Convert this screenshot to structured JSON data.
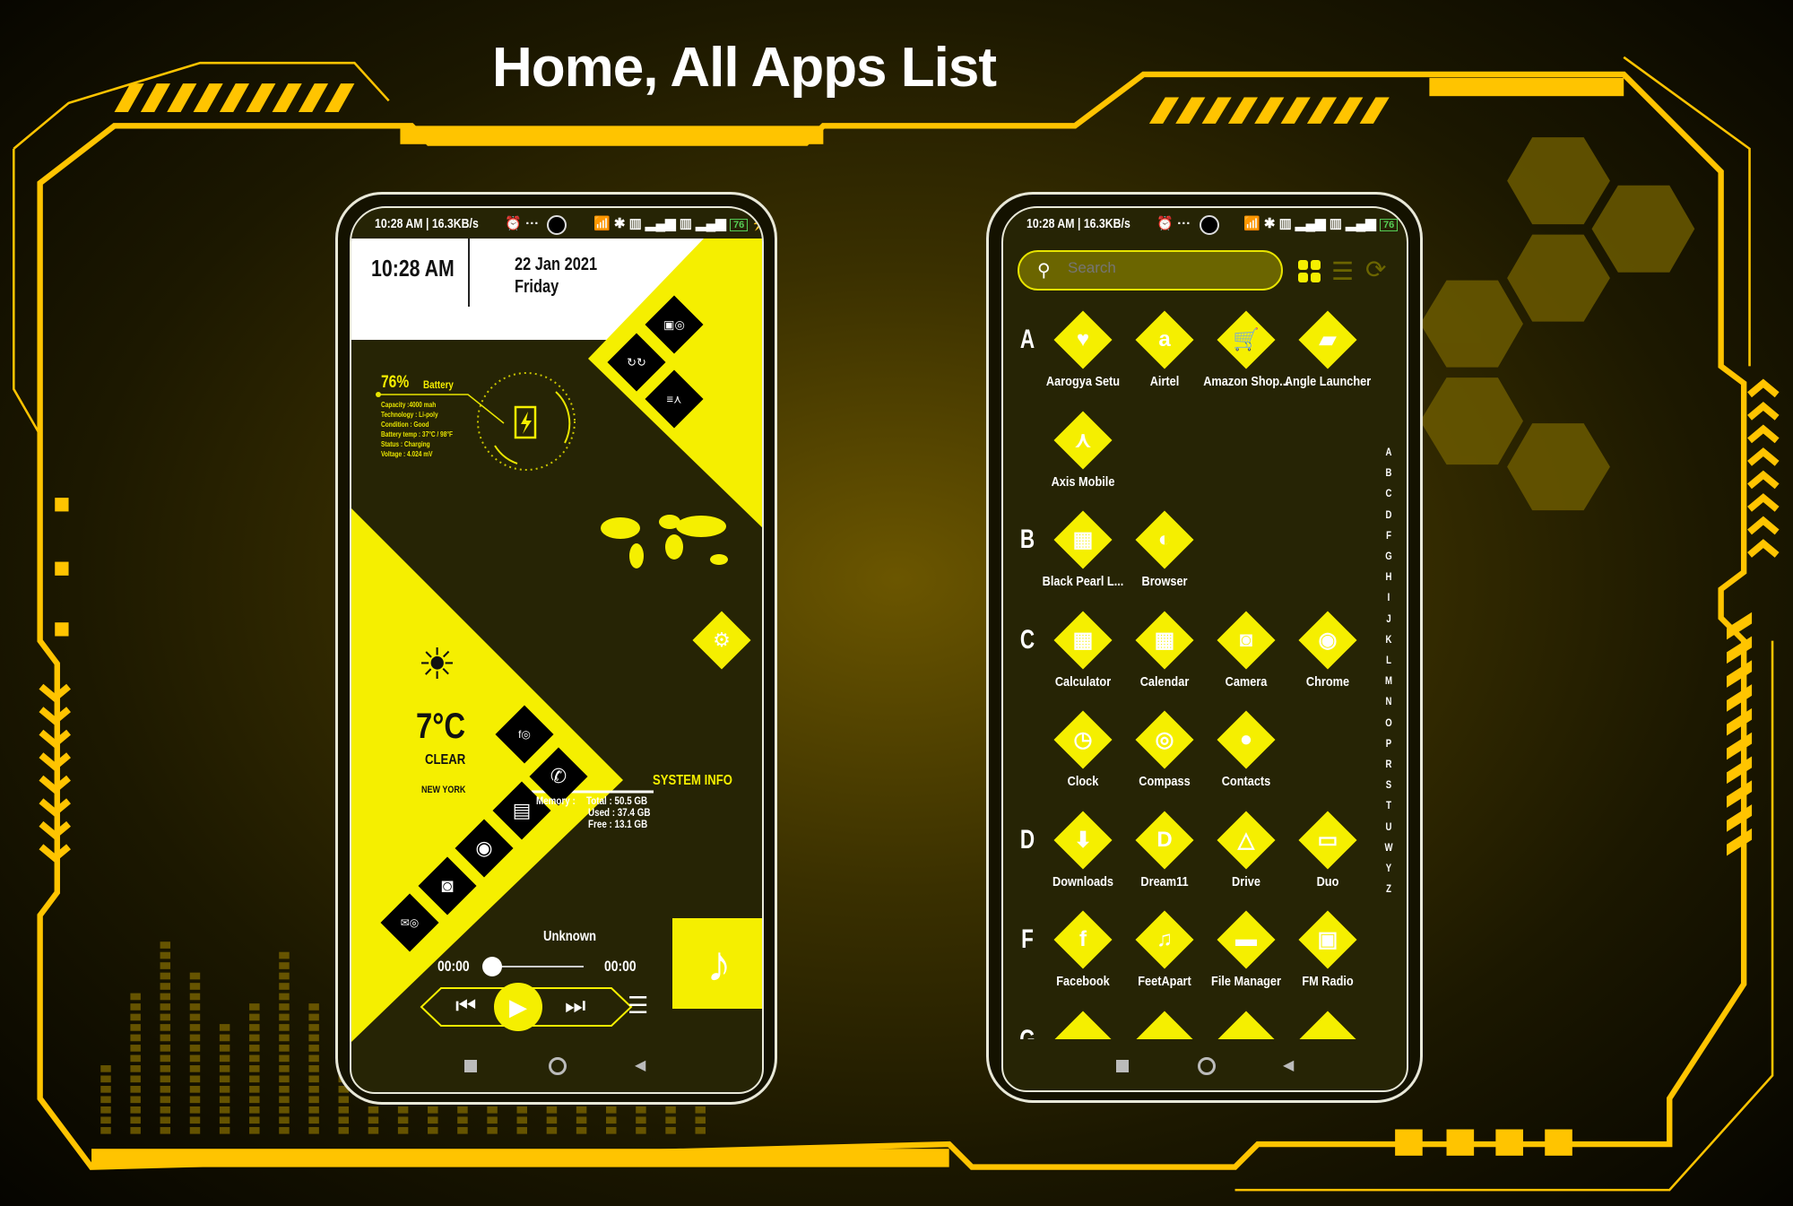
{
  "title": "Home, All Apps List",
  "colors": {
    "accent": "#f5ef00",
    "screen_bg": "#262405",
    "frame": "#ffc400"
  },
  "status_bar": {
    "left": "10:28 AM | 16.3KB/s",
    "battery": "76"
  },
  "home": {
    "time": "10:28 AM",
    "date": "22 Jan 2021",
    "day": "Friday",
    "battery": {
      "percent": "76%",
      "label": "Battery",
      "details": [
        "Capacity :4000 mah",
        "Technology : Li-poly",
        "Condition : Good",
        "Battery temp : 37°C / 98°F",
        "Status : Charging",
        "Voltage : 4.024 mV"
      ]
    },
    "weather": {
      "temp": "7°C",
      "condition": "CLEAR",
      "city": "NEW YORK"
    },
    "system_info": {
      "title": "SYSTEM INFO",
      "memory_label": "Memory :",
      "total": "Total : 50.5 GB",
      "used": "Used : 37.4 GB",
      "free": "Free  : 13.1 GB"
    },
    "music": {
      "track": "Unknown",
      "elapsed": "00:00",
      "duration": "00:00",
      "progress": 0
    }
  },
  "drawer": {
    "search_placeholder": "Search",
    "sections": [
      {
        "letter": "A",
        "apps": [
          "Aarogya Setu",
          "Airtel",
          "Amazon Shop...",
          "Angle Launcher",
          "Axis Mobile"
        ]
      },
      {
        "letter": "B",
        "apps": [
          "Black Pearl L...",
          "Browser"
        ]
      },
      {
        "letter": "C",
        "apps": [
          "Calculator",
          "Calendar",
          "Camera",
          "Chrome",
          "Clock",
          "Compass",
          "Contacts"
        ]
      },
      {
        "letter": "D",
        "apps": [
          "Downloads",
          "Dream11",
          "Drive",
          "Duo"
        ]
      },
      {
        "letter": "F",
        "apps": [
          "Facebook",
          "FeetApart",
          "File Manager",
          "FM Radio"
        ]
      },
      {
        "letter": "G",
        "apps": [
          "",
          "",
          "",
          ""
        ]
      }
    ],
    "index": [
      "A",
      "B",
      "C",
      "D",
      "F",
      "G",
      "H",
      "I",
      "J",
      "K",
      "L",
      "M",
      "N",
      "O",
      "P",
      "R",
      "S",
      "T",
      "U",
      "W",
      "Y",
      "Z"
    ]
  }
}
